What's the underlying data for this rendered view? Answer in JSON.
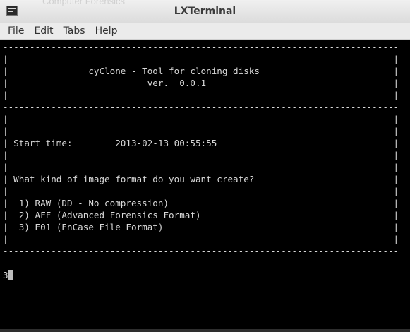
{
  "window": {
    "title": "LXTerminal",
    "background_title_fragment": "Computer Forensics"
  },
  "menubar": {
    "items": [
      "File",
      "Edit",
      "Tabs",
      "Help"
    ]
  },
  "terminal": {
    "colors": {
      "background": "#000000",
      "foreground": "#d8d8d8"
    },
    "lines": [
      "--------------------------------------------------------------------------",
      "|                                                                        |",
      "|               cyClone - Tool for cloning disks                         |",
      "|                          ver.  0.0.1                                   |",
      "|                                                                        |",
      "--------------------------------------------------------------------------",
      "|                                                                        |",
      "|                                                                        |",
      "| Start time:        2013-02-13 00:55:55                                 |",
      "|                                                                        |",
      "|                                                                        |",
      "| What kind of image format do you want create?                          |",
      "|                                                                        |",
      "|  1) RAW (DD - No compression)                                          |",
      "|  2) AFF (Advanced Forensics Format)                                    |",
      "|  3) E01 (EnCase File Format)                                           |",
      "|                                                                        |",
      "--------------------------------------------------------------------------",
      ""
    ],
    "input_value": "3"
  }
}
